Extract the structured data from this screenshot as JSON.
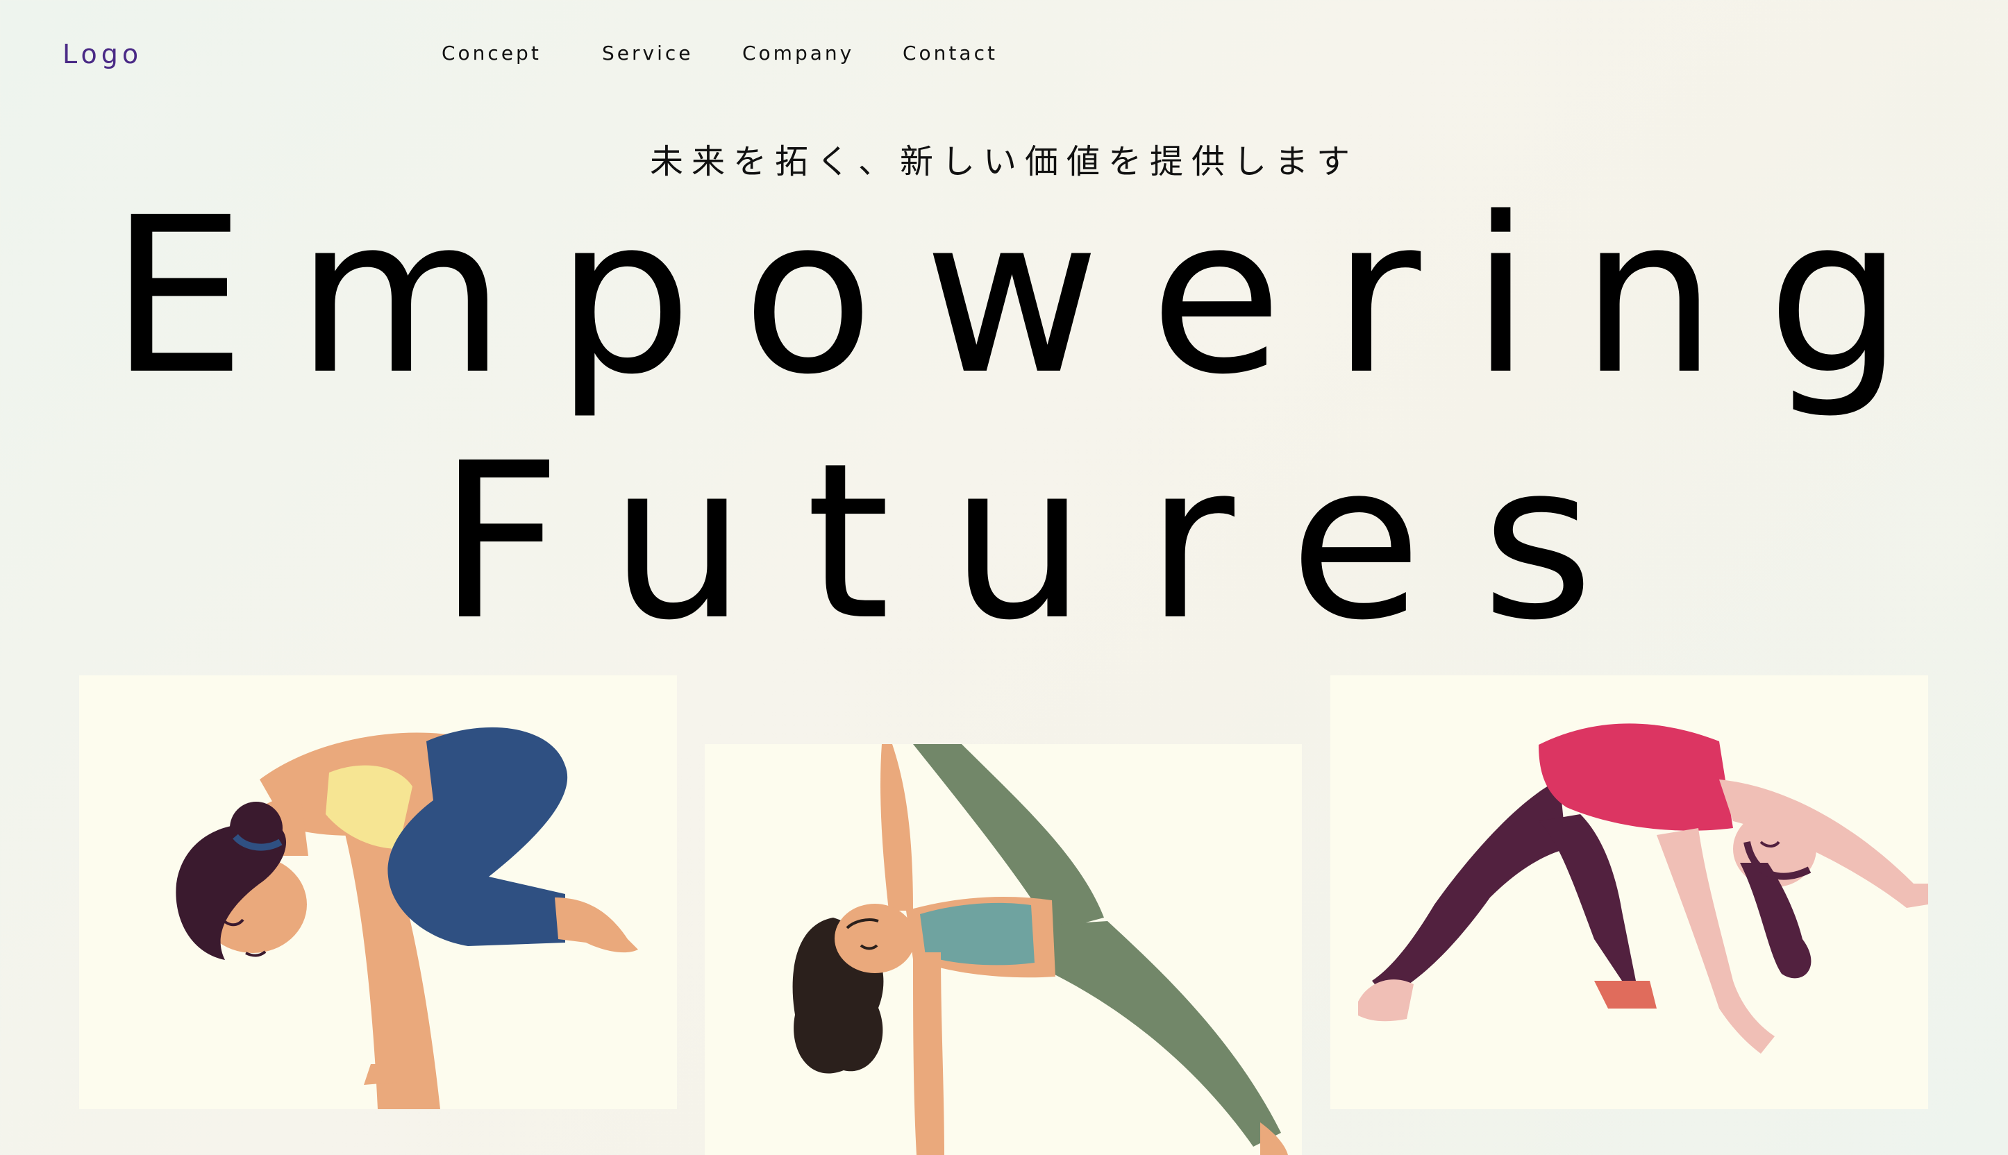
{
  "header": {
    "logo": "Logo",
    "nav": [
      {
        "label": "Concept"
      },
      {
        "label": "Service"
      },
      {
        "label": "Company"
      },
      {
        "label": "Contact"
      }
    ]
  },
  "hero": {
    "tagline": "未来を拓く、新しい価値を提供します",
    "headline_line1": "Empowering",
    "headline_line2": "Futures"
  },
  "gallery": {
    "images": [
      {
        "icon": "yoga-crow-pose-illustration"
      },
      {
        "icon": "yoga-side-plank-illustration"
      },
      {
        "icon": "yoga-wild-thing-pose-illustration"
      }
    ]
  },
  "colors": {
    "logo": "#4a2a86",
    "card_background": "#fdfcee",
    "page_background": "#f5f3ea"
  }
}
